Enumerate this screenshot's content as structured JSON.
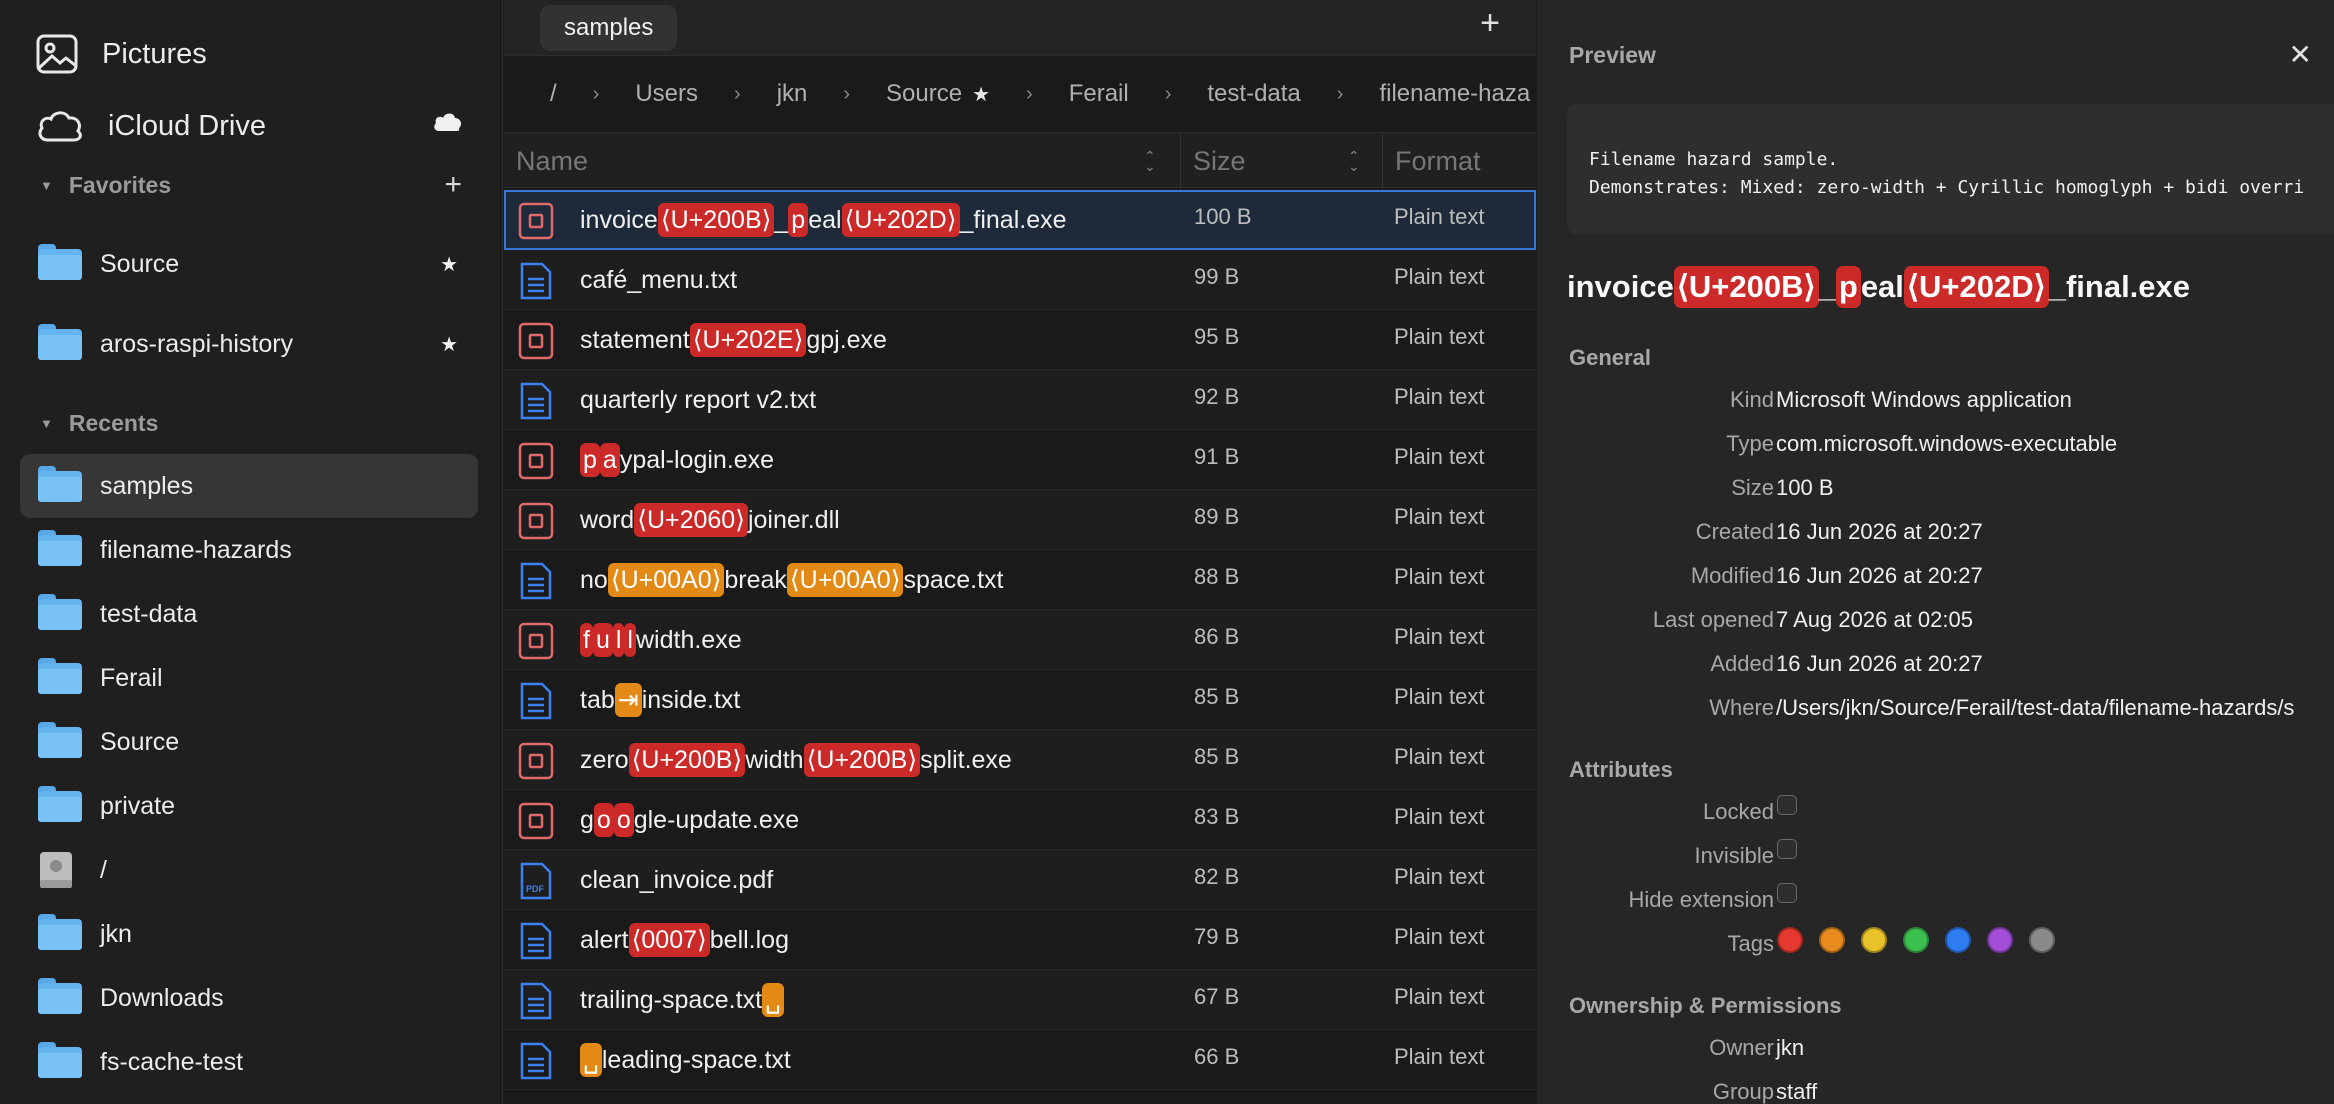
{
  "sidebar": {
    "top_items": [
      {
        "label": "Pictures",
        "icon": "pictures-icon"
      },
      {
        "label": "iCloud Drive",
        "icon": "cloud-icon"
      }
    ],
    "favorites": {
      "title": "Favorites",
      "items": [
        {
          "label": "Source",
          "starred": true
        },
        {
          "label": "aros-raspi-history",
          "starred": true
        }
      ]
    },
    "recents": {
      "title": "Recents",
      "items": [
        {
          "label": "samples",
          "selected": true
        },
        {
          "label": "filename-hazards"
        },
        {
          "label": "test-data"
        },
        {
          "label": "Ferail"
        },
        {
          "label": "Source"
        },
        {
          "label": "private"
        },
        {
          "label": "/",
          "icon": "disk-icon"
        },
        {
          "label": "jkn",
          "icon": "home-folder-icon"
        },
        {
          "label": "Downloads",
          "icon": "downloads-folder-icon"
        },
        {
          "label": "fs-cache-test"
        }
      ]
    }
  },
  "tabs": {
    "active": "samples",
    "add_label": "+"
  },
  "breadcrumb": [
    "/",
    "Users",
    "jkn",
    "Source",
    "Ferail",
    "test-data",
    "filename-haza"
  ],
  "columns": {
    "name": "Name",
    "size": "Size",
    "format": "Plain text",
    "format_header": "Format"
  },
  "files": [
    {
      "parts": [
        [
          "invoice",
          ""
        ],
        [
          "⟨U+200B⟩",
          "red"
        ],
        [
          "_",
          ""
        ],
        [
          "p",
          "red"
        ],
        [
          "eal",
          ""
        ],
        [
          "⟨U+202D⟩",
          "red"
        ],
        [
          "_final.exe",
          ""
        ]
      ],
      "size": "100 B",
      "format": "Plain text",
      "icon": "exe",
      "selected": true
    },
    {
      "parts": [
        [
          "café_menu.txt",
          ""
        ]
      ],
      "size": "99 B",
      "format": "Plain text",
      "icon": "doc"
    },
    {
      "parts": [
        [
          "statement",
          ""
        ],
        [
          "⟨U+202E⟩",
          "red"
        ],
        [
          "gpj.exe",
          ""
        ]
      ],
      "size": "95 B",
      "format": "Plain text",
      "icon": "exe"
    },
    {
      "parts": [
        [
          "quarterly report v2.txt",
          ""
        ]
      ],
      "size": "92 B",
      "format": "Plain text",
      "icon": "doc"
    },
    {
      "parts": [
        [
          "p",
          "red"
        ],
        [
          "a",
          "red"
        ],
        [
          "ypal-login.exe",
          ""
        ]
      ],
      "size": "91 B",
      "format": "Plain text",
      "icon": "exe"
    },
    {
      "parts": [
        [
          "word",
          ""
        ],
        [
          "⟨U+2060⟩",
          "red"
        ],
        [
          "joiner.dll",
          ""
        ]
      ],
      "size": "89 B",
      "format": "Plain text",
      "icon": "exe"
    },
    {
      "parts": [
        [
          "no",
          ""
        ],
        [
          "⟨U+00A0⟩",
          "ora"
        ],
        [
          "break",
          ""
        ],
        [
          "⟨U+00A0⟩",
          "ora"
        ],
        [
          "space.txt",
          ""
        ]
      ],
      "size": "88 B",
      "format": "Plain text",
      "icon": "doc"
    },
    {
      "parts": [
        [
          "f",
          "red"
        ],
        [
          "u",
          "red"
        ],
        [
          "l",
          "red"
        ],
        [
          "l",
          "red"
        ],
        [
          "width.exe",
          ""
        ]
      ],
      "size": "86 B",
      "format": "Plain text",
      "icon": "exe"
    },
    {
      "parts": [
        [
          "tab",
          ""
        ],
        [
          "⇥",
          "ora"
        ],
        [
          "inside.txt",
          ""
        ]
      ],
      "size": "85 B",
      "format": "Plain text",
      "icon": "doc"
    },
    {
      "parts": [
        [
          "zero",
          ""
        ],
        [
          "⟨U+200B⟩",
          "red"
        ],
        [
          "width",
          ""
        ],
        [
          "⟨U+200B⟩",
          "red"
        ],
        [
          "split.exe",
          ""
        ]
      ],
      "size": "85 B",
      "format": "Plain text",
      "icon": "exe"
    },
    {
      "parts": [
        [
          "g",
          ""
        ],
        [
          "o",
          "red"
        ],
        [
          "o",
          "red"
        ],
        [
          "gle-update.exe",
          ""
        ]
      ],
      "size": "83 B",
      "format": "Plain text",
      "icon": "exe"
    },
    {
      "parts": [
        [
          "clean_invoice.pdf",
          ""
        ]
      ],
      "size": "82 B",
      "format": "Plain text",
      "icon": "pdf"
    },
    {
      "parts": [
        [
          "alert",
          ""
        ],
        [
          "⟨0007⟩",
          "red"
        ],
        [
          "bell.log",
          ""
        ]
      ],
      "size": "79 B",
      "format": "Plain text",
      "icon": "doc"
    },
    {
      "parts": [
        [
          "trailing-space.txt",
          ""
        ],
        [
          "␣",
          "ora"
        ]
      ],
      "size": "67 B",
      "format": "Plain text",
      "icon": "doc"
    },
    {
      "parts": [
        [
          "␣",
          "ora"
        ],
        [
          "leading-space.txt",
          ""
        ]
      ],
      "size": "66 B",
      "format": "Plain text",
      "icon": "doc"
    }
  ],
  "inspector": {
    "title": "Preview",
    "preview_text": "Filename hazard sample.\nDemonstrates: Mixed: zero-width + Cyrillic homoglyph + bidi overri",
    "name_parts": [
      [
        "invoice",
        ""
      ],
      [
        "⟨U+200B⟩",
        "red"
      ],
      [
        "_",
        ""
      ],
      [
        "p",
        "red"
      ],
      [
        "eal",
        ""
      ],
      [
        "⟨U+202D⟩",
        "red"
      ],
      [
        "_final.exe",
        ""
      ]
    ],
    "general_title": "General",
    "general": [
      {
        "k": "Kind",
        "v": "Microsoft Windows application"
      },
      {
        "k": "Type",
        "v": "com.microsoft.windows-executable"
      },
      {
        "k": "Size",
        "v": "100 B"
      },
      {
        "k": "Created",
        "v": "16 Jun 2026 at 20:27"
      },
      {
        "k": "Modified",
        "v": "16 Jun 2026 at 20:27"
      },
      {
        "k": "Last opened",
        "v": "7 Aug 2026 at 02:05"
      },
      {
        "k": "Added",
        "v": "16 Jun 2026 at 20:27"
      },
      {
        "k": "Where",
        "v": "/Users/jkn/Source/Ferail/test-data/filename-hazards/s"
      }
    ],
    "attributes_title": "Attributes",
    "attributes": [
      {
        "k": "Locked",
        "checked": false
      },
      {
        "k": "Invisible",
        "checked": false
      },
      {
        "k": "Hide extension",
        "checked": false
      }
    ],
    "tags_label": "Tags",
    "tag_colors": [
      "#e5392f",
      "#e88a1e",
      "#e8c22b",
      "#3bbf4f",
      "#2e7cf0",
      "#a24ed6",
      "#8a8a8a"
    ],
    "ownership_title": "Ownership & Permissions",
    "ownership": [
      {
        "k": "Owner",
        "v": "jkn"
      },
      {
        "k": "Group",
        "v": "staff"
      }
    ]
  }
}
